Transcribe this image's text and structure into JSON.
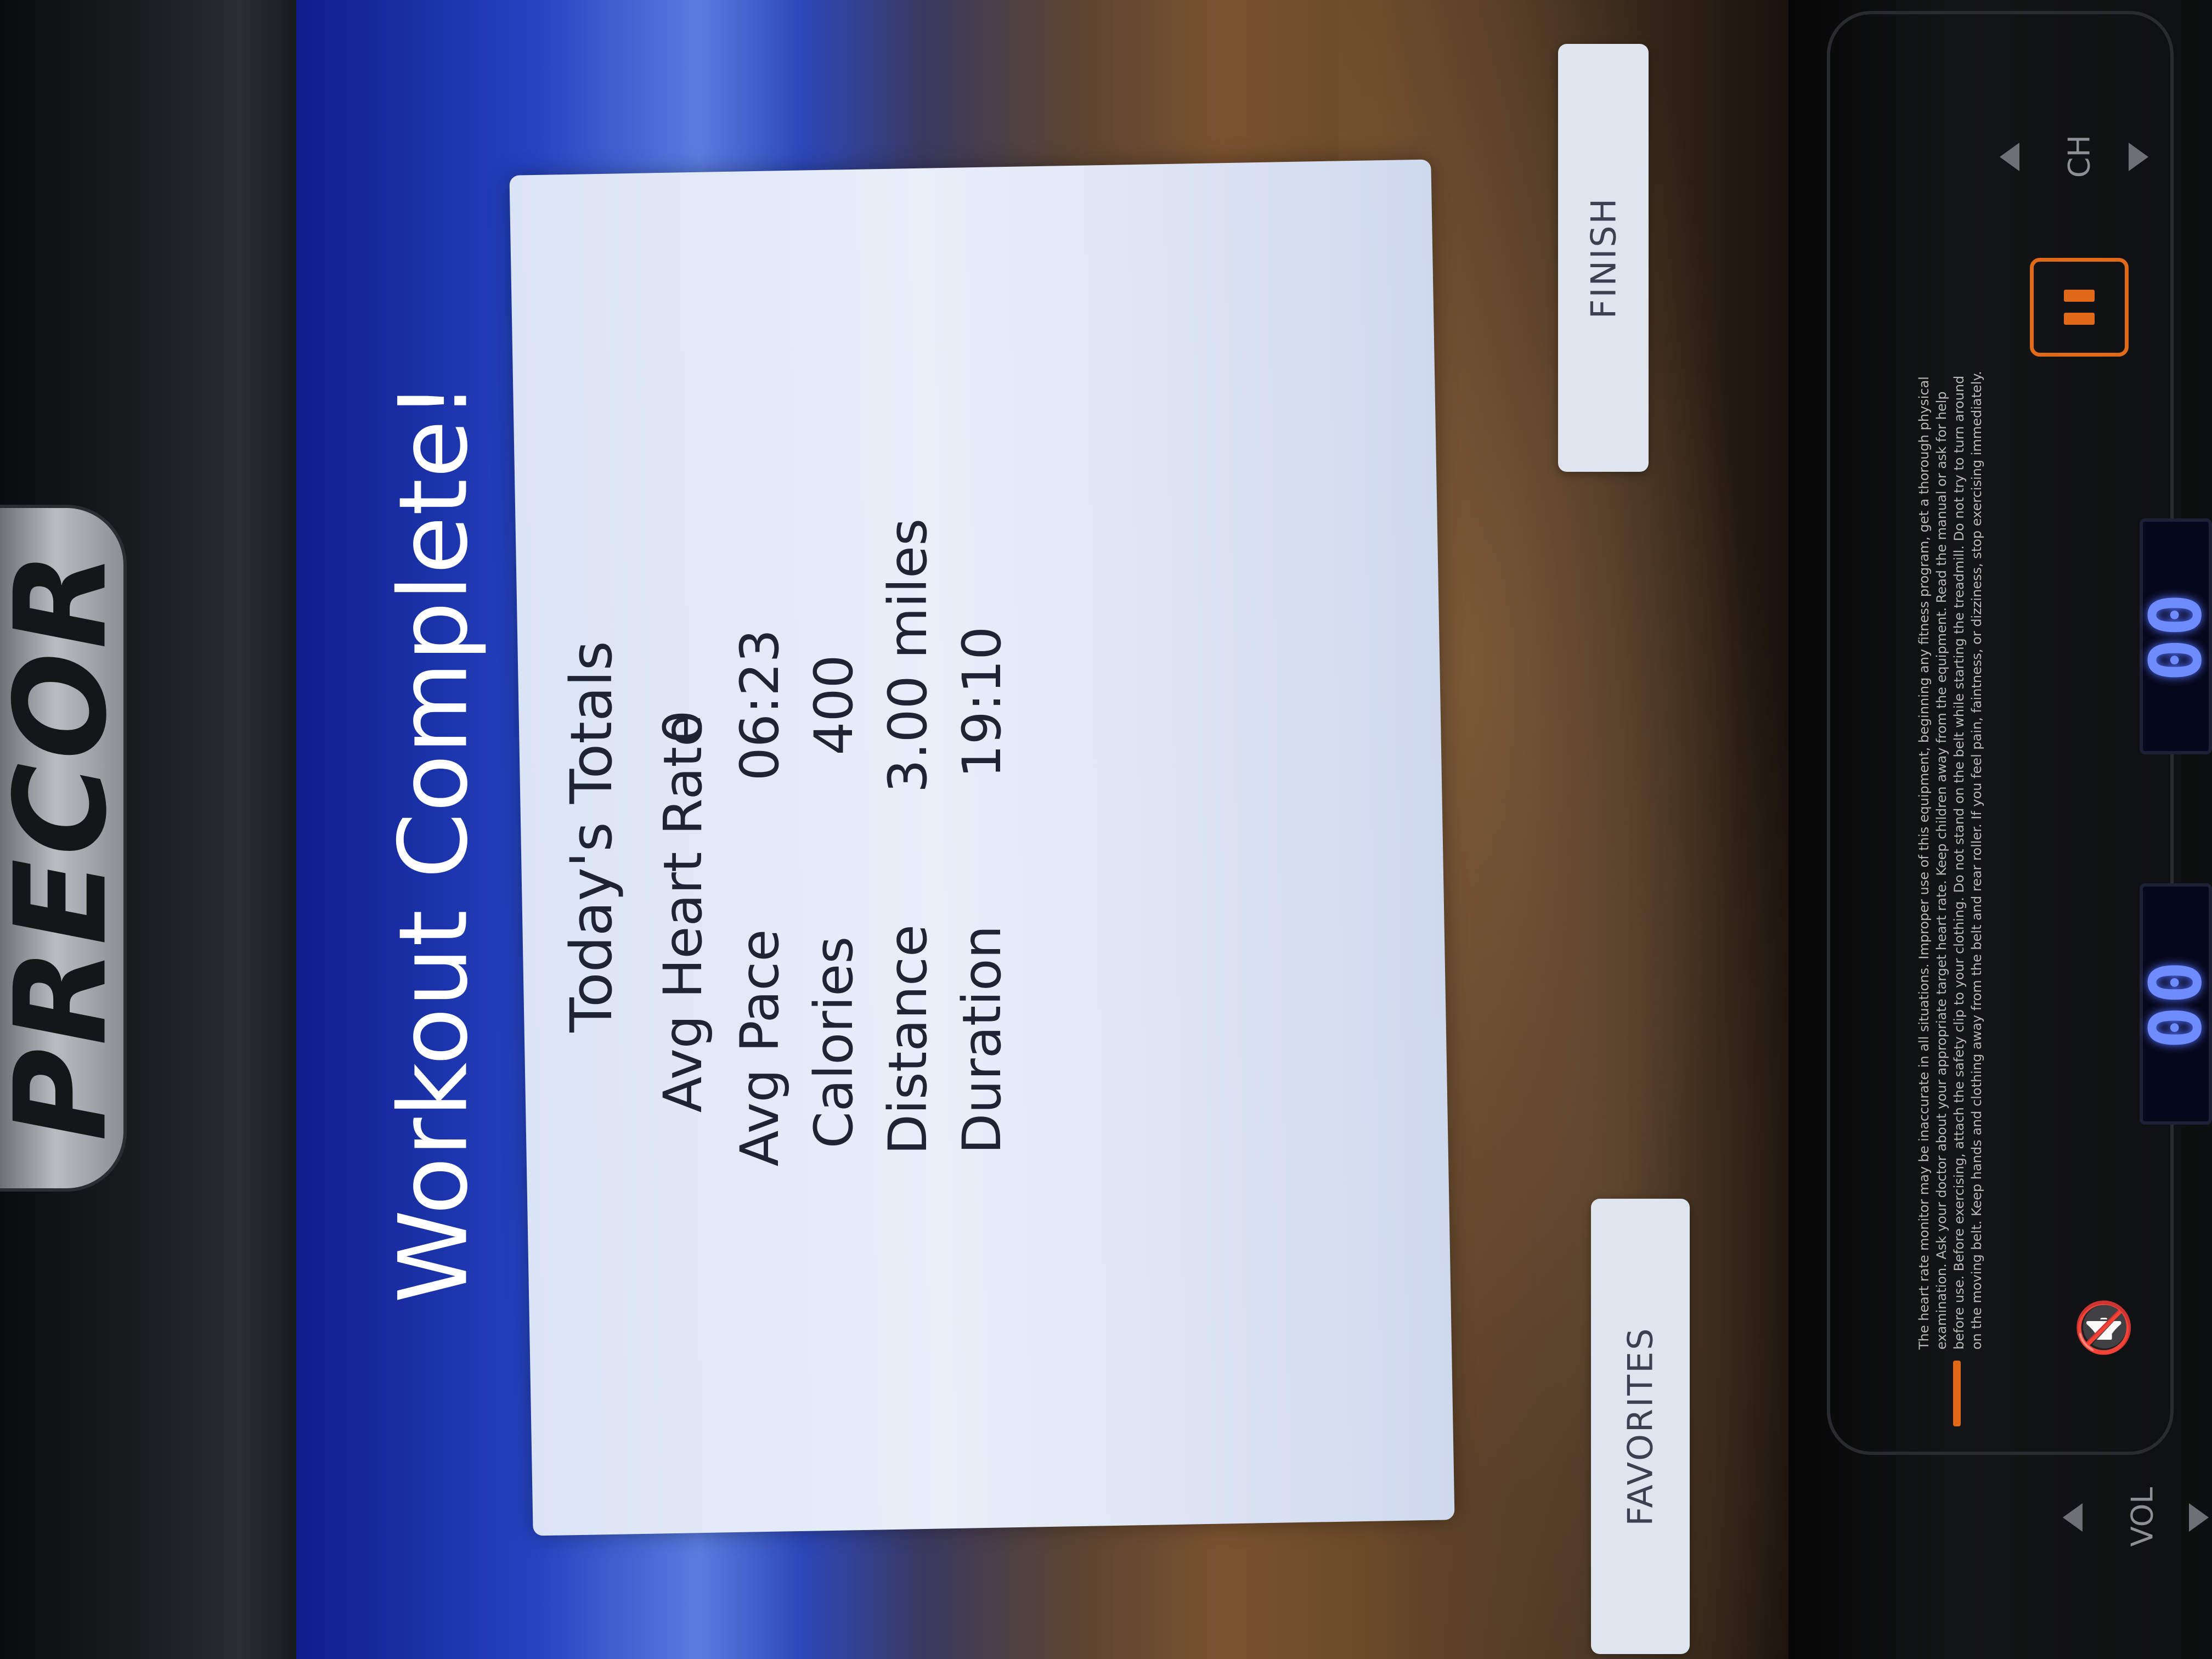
{
  "brand": {
    "logo_text": "PRECOR"
  },
  "screen": {
    "title": "Workout Complete!",
    "section_title": "Today's Totals",
    "stats": [
      {
        "label": "Avg Heart Rate",
        "value": "0"
      },
      {
        "label": "Avg Pace",
        "value": "06:23"
      },
      {
        "label": "Calories",
        "value": "400"
      },
      {
        "label": "Distance",
        "value": "3.00 miles"
      },
      {
        "label": "Duration",
        "value": "19:10"
      }
    ],
    "buttons": {
      "favorites": "FAVORITES",
      "finish": "FINISH"
    }
  },
  "console": {
    "warning_text": "The heart rate monitor may be inaccurate in all situations. Improper use of this equipment, beginning any fitness program, get a thorough physical examination. Ask your doctor about your appropriate target heart rate. Keep children away from the equipment. Read the manual or ask for help before use. Before exercising, attach the safety clip to your clothing. Do not stand on the belt while starting the treadmill. Do not try to turn around on the moving belt. Keep hands and clothing away from the belt and rear roller. If you feel pain, faintness, or dizziness, stop exercising immediately.",
    "channel_label": "CH",
    "volume_label": "VOL",
    "lcd_left": "00",
    "lcd_right": "00",
    "icons": {
      "pause": "pause-icon",
      "mute": "mute-icon",
      "up": "triangle-up-icon",
      "down": "triangle-down-icon"
    }
  },
  "colors": {
    "accent_orange": "#e06a1a",
    "lcd_blue": "#6f8cff",
    "screen_blue": "#2443c0"
  }
}
